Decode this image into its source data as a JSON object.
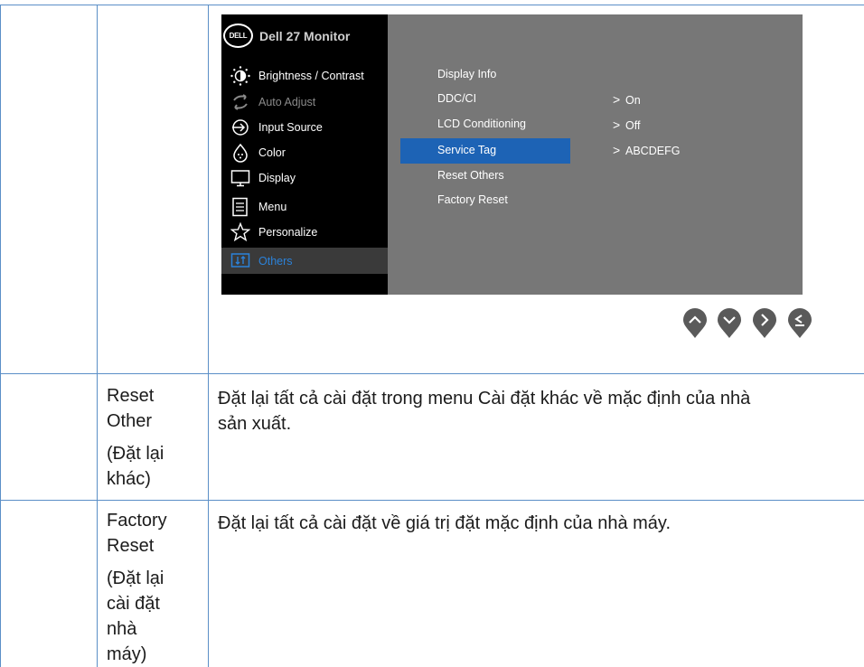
{
  "osd": {
    "logo_text": "DELL",
    "title": "Dell 27 Monitor",
    "menu_items": [
      {
        "label": "Brightness / Contrast",
        "icon": "brightness-icon"
      },
      {
        "label": "Auto Adjust",
        "icon": "auto-adjust-icon"
      },
      {
        "label": "Input Source",
        "icon": "input-source-icon"
      },
      {
        "label": "Color",
        "icon": "color-icon"
      },
      {
        "label": "Display",
        "icon": "display-icon"
      },
      {
        "label": "Menu",
        "icon": "menu-icon"
      },
      {
        "label": "Personalize",
        "icon": "star-icon"
      },
      {
        "label": "Others",
        "icon": "others-icon"
      }
    ],
    "submenu": [
      {
        "label": "Display Info"
      },
      {
        "label": "DDC/CI"
      },
      {
        "label": "LCD Conditioning"
      },
      {
        "label": "Service Tag"
      },
      {
        "label": "Reset Others"
      },
      {
        "label": "Factory Reset"
      }
    ],
    "values": [
      {
        "chevron": ">",
        "label": "On"
      },
      {
        "chevron": ">",
        "label": "Off"
      },
      {
        "chevron": ">",
        "label": "ABCDEFG"
      }
    ],
    "colors": {
      "highlight": "#1d63b5",
      "active_text": "#2b82d9",
      "panel": "#777777"
    }
  },
  "nav_buttons": [
    "up-icon",
    "down-icon",
    "right-icon",
    "back-icon"
  ],
  "rows": [
    {
      "name_lines": [
        "Reset",
        "Other",
        "(Đặt lại",
        "khác)"
      ],
      "description_lines": [
        "Đặt lại tất cả cài đặt trong menu Cài đặt khác về mặc định của nhà",
        "sản xuất."
      ]
    },
    {
      "name_lines": [
        "Factory",
        "Reset",
        "(Đặt lại",
        "cài đặt",
        "nhà",
        "máy)"
      ],
      "description_lines": [
        "Đặt lại tất cả cài đặt về giá trị đặt mặc định của nhà máy."
      ]
    }
  ]
}
